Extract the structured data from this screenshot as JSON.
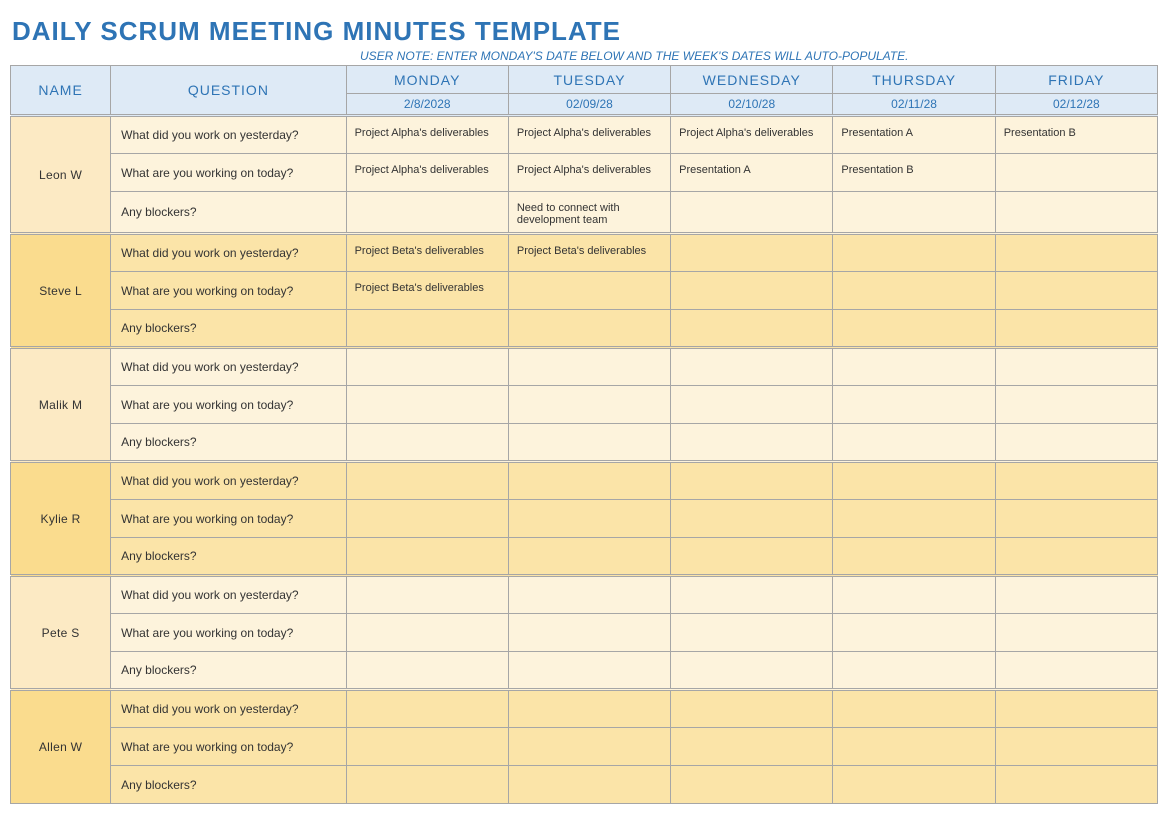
{
  "title": "DAILY SCRUM MEETING MINUTES TEMPLATE",
  "user_note": "USER NOTE: ENTER MONDAY'S DATE BELOW AND THE WEEK'S DATES WILL AUTO-POPULATE.",
  "headers": {
    "name": "NAME",
    "question": "QUESTION",
    "days": [
      "MONDAY",
      "TUESDAY",
      "WEDNESDAY",
      "THURSDAY",
      "FRIDAY"
    ],
    "dates": [
      "2/8/2028",
      "02/09/28",
      "02/10/28",
      "02/11/28",
      "02/12/28"
    ]
  },
  "questions": [
    "What did you work on yesterday?",
    "What are you working on today?",
    "Any blockers?"
  ],
  "people": [
    {
      "name": "Leon W",
      "rows": [
        [
          "Project Alpha's deliverables",
          "Project Alpha's deliverables",
          "Project Alpha's deliverables",
          "Presentation A",
          "Presentation B"
        ],
        [
          "Project Alpha's deliverables",
          "Project Alpha's deliverables",
          "Presentation A",
          "Presentation B",
          ""
        ],
        [
          "",
          "Need to connect with development team",
          "",
          "",
          ""
        ]
      ]
    },
    {
      "name": "Steve L",
      "rows": [
        [
          "Project Beta's deliverables",
          "Project Beta's deliverables",
          "",
          "",
          ""
        ],
        [
          "Project Beta's deliverables",
          "",
          "",
          "",
          ""
        ],
        [
          "",
          "",
          "",
          "",
          ""
        ]
      ]
    },
    {
      "name": "Malik M",
      "rows": [
        [
          "",
          "",
          "",
          "",
          ""
        ],
        [
          "",
          "",
          "",
          "",
          ""
        ],
        [
          "",
          "",
          "",
          "",
          ""
        ]
      ]
    },
    {
      "name": "Kylie R",
      "rows": [
        [
          "",
          "",
          "",
          "",
          ""
        ],
        [
          "",
          "",
          "",
          "",
          ""
        ],
        [
          "",
          "",
          "",
          "",
          ""
        ]
      ]
    },
    {
      "name": "Pete S",
      "rows": [
        [
          "",
          "",
          "",
          "",
          ""
        ],
        [
          "",
          "",
          "",
          "",
          ""
        ],
        [
          "",
          "",
          "",
          "",
          ""
        ]
      ]
    },
    {
      "name": "Allen W",
      "rows": [
        [
          "",
          "",
          "",
          "",
          ""
        ],
        [
          "",
          "",
          "",
          "",
          ""
        ],
        [
          "",
          "",
          "",
          "",
          ""
        ]
      ]
    }
  ]
}
